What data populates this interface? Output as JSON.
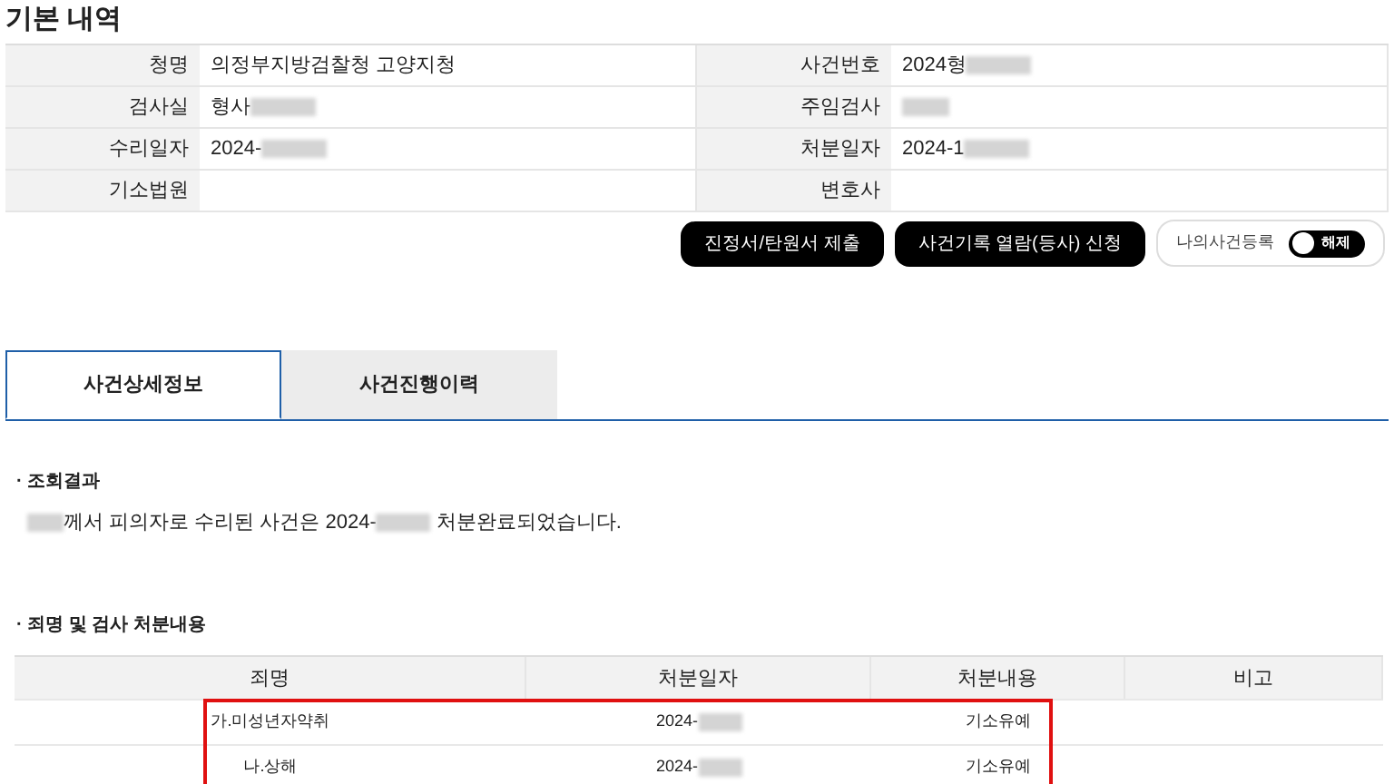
{
  "title": "기본 내역",
  "info": [
    {
      "label": "청명",
      "value": "의정부지방검찰청 고양지청",
      "redacted": false
    },
    {
      "label": "사건번호",
      "value": "2024형",
      "redacted": true
    },
    {
      "label": "검사실",
      "value": "형사",
      "redacted": true
    },
    {
      "label": "주임검사",
      "redacted": true
    },
    {
      "label": "수리일자",
      "value": "2024-",
      "redacted": true
    },
    {
      "label": "처분일자",
      "value": "2024-1",
      "redacted": true
    },
    {
      "label": "기소법원",
      "redacted": false
    },
    {
      "label": "변호사",
      "redacted": false
    }
  ],
  "buttons": [
    "진정서/탄원서 제출",
    "사건기록 열람(등사) 신청"
  ],
  "my_case": {
    "label": "나의사건등록",
    "switch_text": "해제",
    "on": false
  },
  "tabs": [
    {
      "label": "사건상세정보",
      "selected": true
    },
    {
      "label": "사건진행이력",
      "selected": false
    }
  ],
  "result": {
    "bullet": "·",
    "heading": "조회결과",
    "message_prefix_redacted": true,
    "message_start": "께서 피의자로 수리된 사건은 2024-",
    "message_end": "처분완료되었습니다."
  },
  "charges": {
    "bullet": "·",
    "heading": "죄명 및 검사 처분내용",
    "columns": [
      "죄명",
      "처분일자",
      "처분내용",
      "비고"
    ],
    "rows": [
      {
        "name": "가.미성년자약취",
        "date": "2024-",
        "date_redacted": true,
        "result": "기소유예",
        "highlighted": true
      },
      {
        "name": "나.상해",
        "date": "2024-",
        "date_redacted": true,
        "result": "기소유예",
        "highlighted": true
      }
    ]
  }
}
